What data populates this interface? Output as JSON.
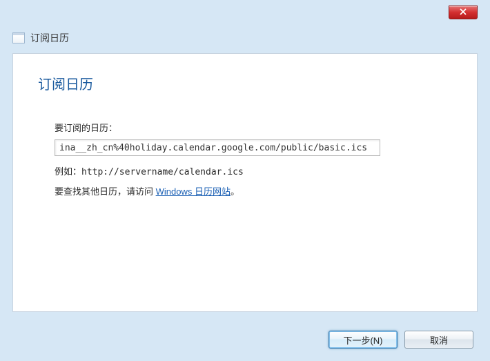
{
  "window": {
    "title": "订阅日历"
  },
  "content": {
    "heading": "订阅日历",
    "field_label": "要订阅的日历：",
    "url_value": "ina__zh_cn%40holiday.calendar.google.com/public/basic.ics",
    "example": "例如：http://servername/calendar.ics",
    "help_prefix": "要查找其他日历，请访问 ",
    "help_link_text": "Windows 日历网站",
    "help_suffix": "。"
  },
  "buttons": {
    "next": "下一步(N)",
    "cancel": "取消"
  }
}
